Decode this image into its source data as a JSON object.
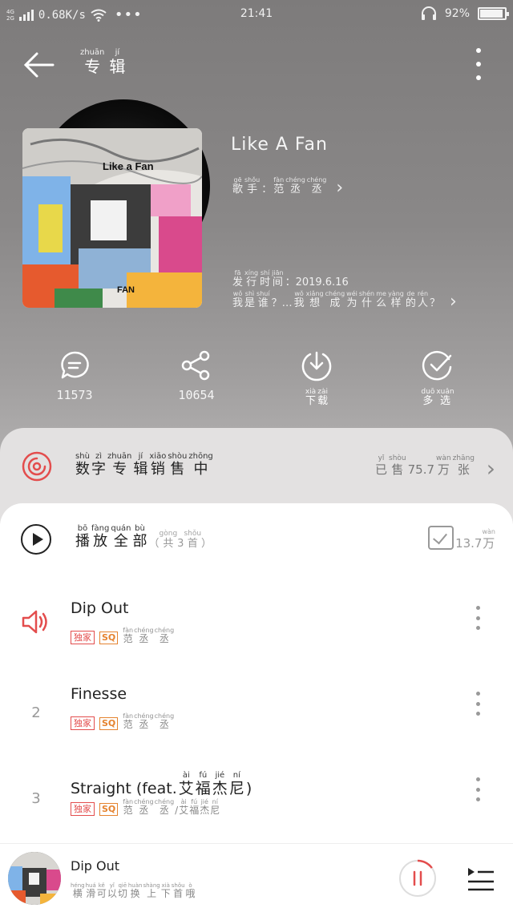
{
  "status_bar": {
    "network_top": "4G",
    "network_bottom": "2G",
    "speed": "0.68K/s",
    "more": "•••",
    "time": "21:41",
    "battery_text": "92%",
    "battery_level": 0.92
  },
  "header": {
    "title_pinyin": [
      "zhuān",
      "jí"
    ],
    "title_hanzi": [
      "专",
      "辑"
    ]
  },
  "album": {
    "name": "Like A Fan",
    "cover_text_top": "Like a Fan",
    "cover_text_bottom": "FAN",
    "singer_label_pinyin": [
      "gē",
      "shǒu"
    ],
    "singer_label_hanzi": [
      "歌",
      "手",
      "："
    ],
    "singer_pinyin": [
      "fàn",
      "chéng",
      "chéng"
    ],
    "singer_hanzi": [
      "范",
      "丞",
      "丞"
    ],
    "release_label_pinyin": [
      "fā",
      "xíng",
      "shí",
      "jiān"
    ],
    "release_label_hanzi": [
      "发",
      "行",
      "时",
      "间"
    ],
    "release_date": "：2019.6.16",
    "desc_pinyin": [
      "wǒ",
      "shì",
      "shuí",
      "",
      "wǒ",
      "xiǎng",
      "chéng",
      "wéi",
      "shén",
      "me",
      "yàng",
      "de",
      "rén",
      ""
    ],
    "desc_hanzi": [
      "我",
      "是",
      "谁",
      "？…",
      "我",
      "想",
      "成",
      "为",
      "什",
      "么",
      "样",
      "的",
      "人",
      "？"
    ]
  },
  "actions": {
    "comments_count": "11573",
    "share_count": "10654",
    "download_pinyin": [
      "xià",
      "zài"
    ],
    "download_hanzi": [
      "下",
      "载"
    ],
    "multi_pinyin": [
      "duō",
      "xuǎn"
    ],
    "multi_hanzi": [
      "多",
      "选"
    ]
  },
  "digital": {
    "title_pinyin": [
      "shù",
      "zì",
      "zhuān",
      "jí",
      "xiāo",
      "shòu",
      "zhōng"
    ],
    "title_hanzi": [
      "数",
      "字",
      "专",
      "辑",
      "销",
      "售",
      "中"
    ],
    "sold_pinyin": [
      "yǐ",
      "shòu"
    ],
    "sold_hanzi": [
      "已",
      "售"
    ],
    "sold_number": "75.7",
    "sold_unit_pinyin": [
      "wàn",
      "zhāng"
    ],
    "sold_unit_hanzi": [
      "万",
      "张"
    ]
  },
  "list": {
    "play_all_pinyin": [
      "bō",
      "fàng",
      "quán",
      "bù"
    ],
    "play_all_hanzi": [
      "播",
      "放",
      "全",
      "部"
    ],
    "count_pre": "（",
    "count_pinyin": [
      "gòng",
      "",
      "shǒu"
    ],
    "count_hanzi": [
      "共",
      "3",
      "首"
    ],
    "count_post": "）",
    "fav_number": "13.7",
    "fav_unit_pinyin": "wàn",
    "fav_unit_hanzi": "万",
    "tag_exclusive": "独家",
    "tag_sq": "SQ",
    "songs": [
      {
        "index": "",
        "title": "Dip Out",
        "artist_pinyin": [
          "fàn",
          "chéng",
          "chéng"
        ],
        "artist_hanzi": [
          "范",
          "丞",
          "丞"
        ]
      },
      {
        "index": "2",
        "title": "Finesse",
        "artist_pinyin": [
          "fàn",
          "chéng",
          "chéng"
        ],
        "artist_hanzi": [
          "范",
          "丞",
          "丞"
        ]
      },
      {
        "index": "3",
        "title": "Straight (feat.",
        "title_feat_pinyin": [
          "ài",
          "fú",
          "jié",
          "ní"
        ],
        "title_feat_hanzi": [
          "艾",
          "福",
          "杰",
          "尼"
        ],
        "title_end": ")",
        "artist_pinyin": [
          "fàn",
          "chéng",
          "chéng",
          "",
          "ài",
          "fú",
          "jié",
          "ní"
        ],
        "artist_hanzi": [
          "范",
          "丞",
          "丞",
          "/",
          "艾",
          "福",
          "杰",
          "尼"
        ]
      }
    ]
  },
  "player": {
    "title": "Dip Out",
    "hint_pinyin": [
      "héng",
      "huá",
      "kě",
      "yǐ",
      "qiē",
      "huàn",
      "shàng",
      "xià",
      "shǒu",
      "ò"
    ],
    "hint_hanzi": [
      "横",
      "滑",
      "可",
      "以",
      "切",
      "换",
      "上",
      "下",
      "首",
      "哦"
    ],
    "progress": 0.15
  },
  "colors": {
    "accent_red": "#e34d4d",
    "sq_orange": "#e5832f"
  }
}
